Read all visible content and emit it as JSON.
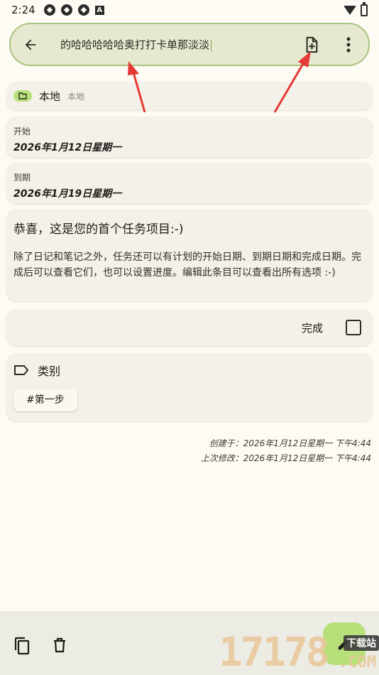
{
  "status_bar": {
    "time": "2:24",
    "icons": [
      "sync-icon",
      "sync-icon",
      "sync-icon",
      "a-icon"
    ],
    "right_icons": [
      "wifi-icon",
      "battery-icon"
    ]
  },
  "title_bar": {
    "title": "的哈哈哈哈哈奥打打卡单那淡淡",
    "back_icon": "arrow-left-icon",
    "add_file_icon": "file-plus-icon",
    "menu_icon": "more-vert-icon"
  },
  "folder": {
    "name": "本地",
    "subtitle": "本地",
    "badge_icon": "folder-icon",
    "badge_color": "#b8e07a"
  },
  "dates": {
    "start_label": "开始",
    "start_value": "2026年1月12日星期一",
    "due_label": "到期",
    "due_value": "2026年1月19日星期一"
  },
  "content": {
    "title": "恭喜，这是您的首个任务项目:-)",
    "body": "除了日记和笔记之外，任务还可以有计划的开始日期、到期日期和完成日期。完成后可以查看它们，也可以设置进度。编辑此条目可以查看出所有选项 :-)"
  },
  "done": {
    "label": "完成",
    "checked": false
  },
  "categories": {
    "title": "类别",
    "icon": "label-icon",
    "items": [
      "#第一步"
    ]
  },
  "meta": {
    "created": "创建于：2026年1月12日星期一 下午4:44",
    "modified": "上次修改：2026年1月12日星期一 下午4:44"
  },
  "bottom_bar": {
    "copy_icon": "copy-icon",
    "delete_icon": "delete-icon",
    "fab_icon": "edit-icon",
    "fab_color": "#b8e07a"
  },
  "watermark": {
    "number": "17178",
    "tag": "下载站",
    "domain": ".COM"
  },
  "colors": {
    "background": "#fdfbf3",
    "card": "#f4f1ea",
    "accent": "#a8c47e",
    "annotation_arrow": "#e53935"
  }
}
